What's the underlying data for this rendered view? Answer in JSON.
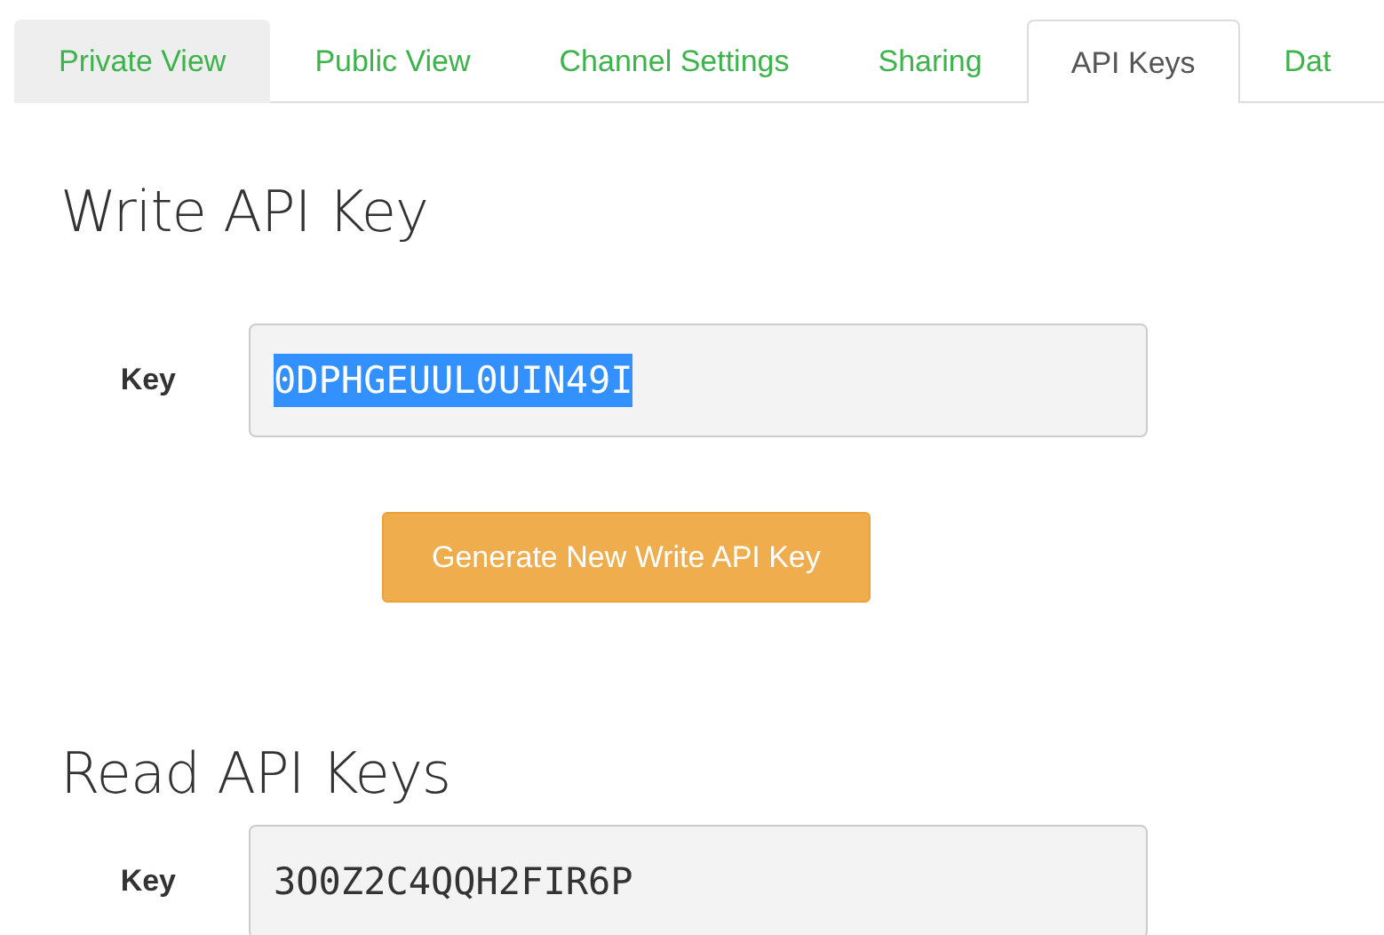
{
  "tabs": [
    {
      "label": "Private View",
      "selected": false,
      "shaded": true
    },
    {
      "label": "Public View",
      "selected": false,
      "shaded": false
    },
    {
      "label": "Channel Settings",
      "selected": false,
      "shaded": false
    },
    {
      "label": "Sharing",
      "selected": false,
      "shaded": false
    },
    {
      "label": "API Keys",
      "selected": true,
      "shaded": false
    },
    {
      "label": "Dat",
      "selected": false,
      "shaded": false
    }
  ],
  "sections": [
    {
      "heading": "Write API Key",
      "label": "Key",
      "value": "0DPHGEUUL0UIN49I",
      "text_selected": true,
      "button": "Generate New Write API Key"
    },
    {
      "heading": "Read API Keys",
      "label": "Key",
      "value": "3O0Z2C4QQH2FIR6P",
      "text_selected": false
    }
  ]
}
